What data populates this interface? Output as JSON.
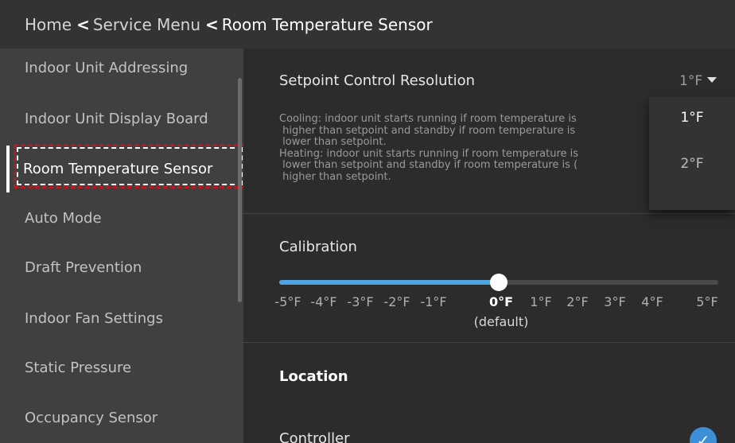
{
  "header": {
    "crumb_home": "Home",
    "crumb_service": "Service Menu",
    "crumb_current": "Room Temperature Sensor",
    "sep_glyph": "<"
  },
  "sidebar": {
    "items": [
      {
        "label": "Indoor Unit Addressing"
      },
      {
        "label": "Indoor Unit Display Board"
      },
      {
        "label": "Room Temperature Sensor"
      },
      {
        "label": "Auto Mode"
      },
      {
        "label": "Draft Prevention"
      },
      {
        "label": "Indoor Fan Settings"
      },
      {
        "label": "Static Pressure"
      },
      {
        "label": "Occupancy Sensor"
      }
    ],
    "active_index": 2
  },
  "setpoint": {
    "title": "Setpoint Control Resolution",
    "value": "1°F",
    "description": "Cooling: indoor unit starts running if room temperature is\n higher than setpoint and standby if room temperature is\n lower than setpoint.\nHeating: indoor unit starts running if room temperature is\n lower than setpoint and standby if room temperature is (\n higher than setpoint.",
    "options": [
      "1°F",
      "2°F"
    ],
    "selected_option": "1°F"
  },
  "calibration": {
    "title": "Calibration",
    "ticks": [
      "-5°F",
      "-4°F",
      "-3°F",
      "-2°F",
      "-1°F",
      "0°F",
      "1°F",
      "2°F",
      "3°F",
      "4°F",
      "5°F"
    ],
    "selected_index": 5,
    "default_label": "(default)",
    "value_fraction": 0.5
  },
  "location": {
    "title": "Location",
    "controller_label": "Controller",
    "check_glyph": "✓",
    "controller_selected": true
  },
  "colors": {
    "accent": "#4ea3e0",
    "focus_border": "#b01e23",
    "check": "#3d8fd8"
  }
}
